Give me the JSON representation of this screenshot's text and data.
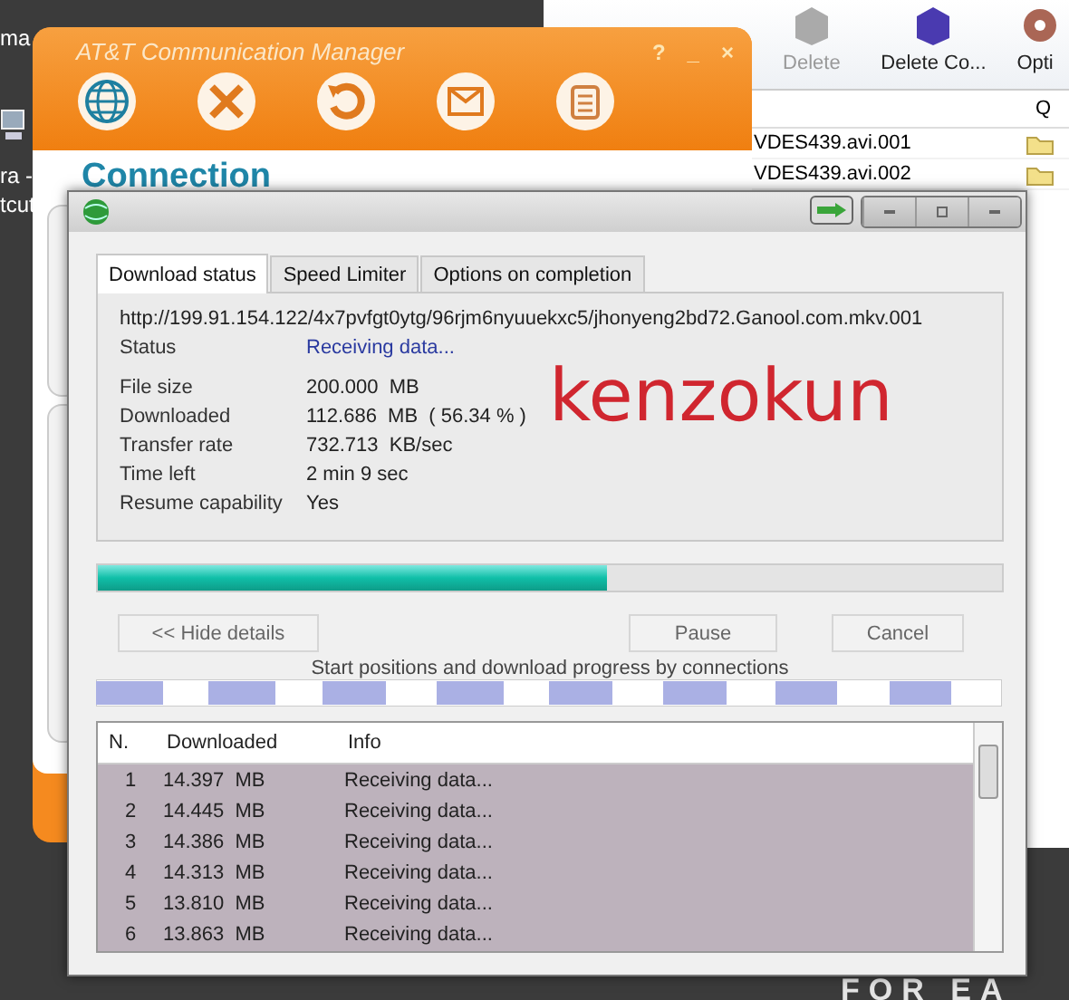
{
  "desktop": {
    "icon_labels": [
      "ma",
      "ra -",
      "tcut"
    ],
    "wallpaper_text": "FOR EA"
  },
  "background_window": {
    "toolbar": [
      {
        "label": "Delete",
        "disabled": true
      },
      {
        "label": "Delete Co...",
        "disabled": false
      },
      {
        "label": "Opti",
        "disabled": false
      }
    ],
    "column_header": "Q",
    "rows": [
      "VDES439.avi.001",
      "VDES439.avi.002"
    ]
  },
  "att_window": {
    "title": "AT&T Communication Manager",
    "controls": [
      "?",
      "_",
      "×"
    ],
    "heading": "Connection"
  },
  "download_window": {
    "tabs": [
      {
        "label": "Download status",
        "selected": true
      },
      {
        "label": "Speed Limiter",
        "selected": false
      },
      {
        "label": "Options on completion",
        "selected": false
      }
    ],
    "url": "http://199.91.154.122/4x7pvfgt0ytg/96rjm6nyuuekxc5/jhonyeng2bd72.Ganool.com.mkv.001",
    "status": {
      "label": "Status",
      "value": "Receiving data..."
    },
    "details": [
      {
        "label": "File size",
        "value": "200.000  MB"
      },
      {
        "label": "Downloaded",
        "value": "112.686  MB  ( 56.34 % )"
      },
      {
        "label": "Transfer rate",
        "value": "732.713  KB/sec"
      },
      {
        "label": "Time left",
        "value": "2 min 9 sec"
      },
      {
        "label": "Resume capability",
        "value": "Yes"
      }
    ],
    "progress": {
      "level": 0.5634
    },
    "buttons": [
      "<< Hide details",
      "Pause",
      "Cancel"
    ],
    "connections_caption": "Start positions and download progress by connections",
    "table": {
      "columns": [
        "N.",
        "Downloaded",
        "Info"
      ],
      "rows": [
        [
          "1",
          "14.397  MB",
          "Receiving data..."
        ],
        [
          "2",
          "14.445  MB",
          "Receiving data..."
        ],
        [
          "3",
          "14.386  MB",
          "Receiving data..."
        ],
        [
          "4",
          "14.313  MB",
          "Receiving data..."
        ],
        [
          "5",
          "13.810  MB",
          "Receiving data..."
        ],
        [
          "6",
          "13.863  MB",
          "Receiving data..."
        ]
      ]
    }
  },
  "overlay_label": "kenzokun"
}
